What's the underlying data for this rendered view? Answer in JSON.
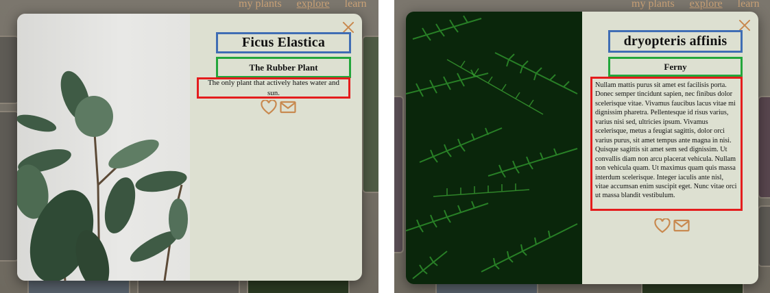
{
  "nav": {
    "my_plants": "my plants",
    "explore": "explore",
    "learn": "learn"
  },
  "modal_left": {
    "title": "Ficus Elastica",
    "subtitle": "The Rubber Plant",
    "description": "The only plant that actively hates water and sun."
  },
  "modal_right": {
    "title": "dryopteris affinis",
    "subtitle": "Ferny",
    "description": "Nullam mattis purus sit amet est facilisis porta. Donec semper tincidunt sapien, nec finibus dolor scelerisque vitae. Vivamus faucibus lacus vitae mi dignissim pharetra. Pellentesque id risus varius, varius nisi sed, ultricies ipsum. Vivamus scelerisque, metus a feugiat sagittis, dolor orci varius purus, sit amet tempus ante magna in nisi. Quisque sagittis sit amet sem sed dignissim. Ut convallis diam non arcu placerat vehicula. Nullam non vehicula quam. Ut maximus quam quis massa interdum scelerisque. Integer iaculis ante nisl, vitae accumsan enim suscipit eget. Nunc vitae orci ut massa blandit vestibulum."
  },
  "icons": {
    "close": "close-icon",
    "heart": "heart-icon",
    "mail": "mail-icon"
  },
  "colors": {
    "accent": "#c8894f",
    "panel_bg": "#dde0d1",
    "title_box_border": "#3f6db4",
    "subtitle_box_border": "#22a63b",
    "description_box_border": "#e41c1c"
  }
}
